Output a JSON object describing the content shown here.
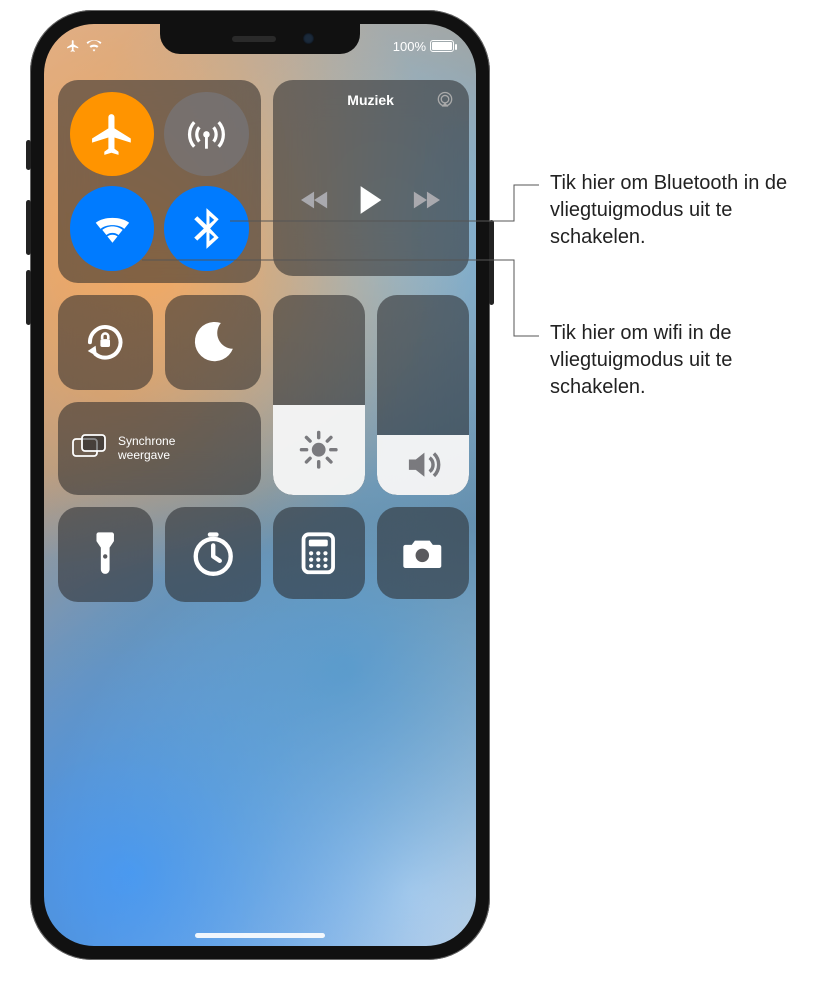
{
  "status": {
    "battery_text": "100%"
  },
  "music": {
    "title": "Muziek"
  },
  "mirror": {
    "label_line1": "Synchrone",
    "label_line2": "weergave"
  },
  "callouts": {
    "bluetooth": "Tik hier om Bluetooth in de vliegtuigmodus uit te schakelen.",
    "wifi": "Tik hier om wifi in de vliegtuigmodus uit te schakelen."
  },
  "icons": {
    "airplane": "airplane",
    "cellular": "cellular-antenna",
    "wifi": "wifi",
    "bluetooth": "bluetooth",
    "airplay": "airplay",
    "prev": "previous-track",
    "play": "play",
    "next": "next-track",
    "orientation_lock": "orientation-lock",
    "dnd": "do-not-disturb",
    "screen_mirror": "screen-mirroring",
    "brightness": "brightness",
    "volume": "volume",
    "flashlight": "flashlight",
    "timer": "timer",
    "calculator": "calculator",
    "camera": "camera"
  }
}
